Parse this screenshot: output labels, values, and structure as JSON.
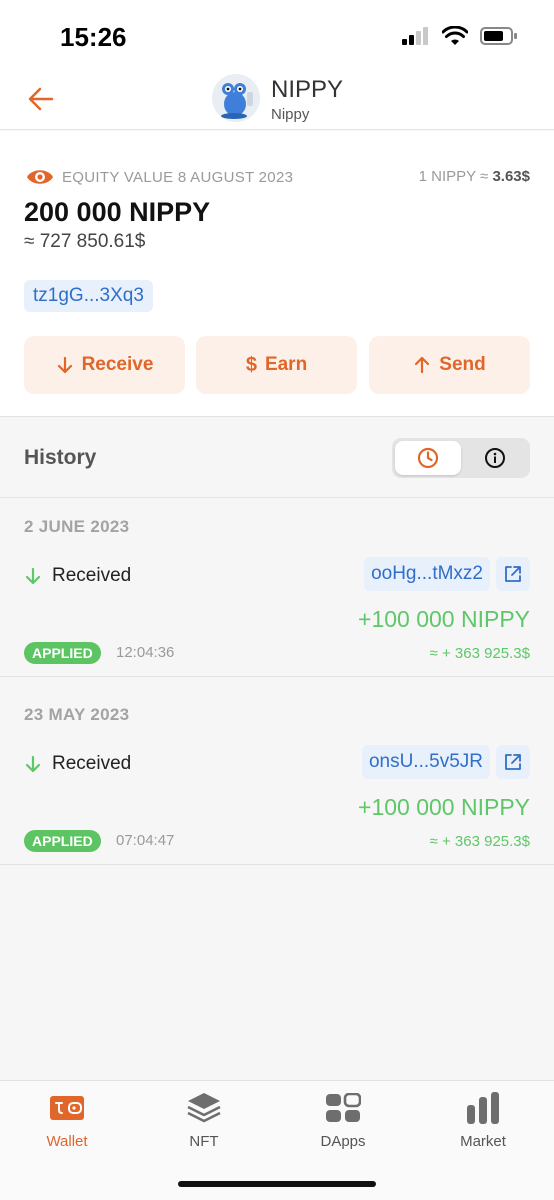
{
  "status_bar": {
    "time": "15:26"
  },
  "header": {
    "title": "NIPPY",
    "subtitle": "Nippy"
  },
  "balance": {
    "equity_label": "EQUITY VALUE 8 AUGUST 2023",
    "rate_prefix": "1 NIPPY ≈",
    "rate_value": "3.63$",
    "amount": "200 000 NIPPY",
    "usd": "≈ 727 850.61$",
    "address": "tz1gG...3Xq3"
  },
  "actions": [
    {
      "label": "Receive",
      "icon": "arrow-down-icon"
    },
    {
      "label": "Earn",
      "icon": "dollar-icon"
    },
    {
      "label": "Send",
      "icon": "arrow-up-icon"
    }
  ],
  "history": {
    "title": "History",
    "groups": [
      {
        "date": "2 JUNE 2023",
        "type": "Received",
        "hash": "ooHg...tMxz2",
        "amount": "+100 000 NIPPY",
        "status": "APPLIED",
        "time": "12:04:36",
        "usd": "≈ + 363 925.3$"
      },
      {
        "date": "23 MAY 2023",
        "type": "Received",
        "hash": "onsU...5v5JR",
        "amount": "+100 000 NIPPY",
        "status": "APPLIED",
        "time": "07:04:47",
        "usd": "≈ + 363 925.3$"
      }
    ]
  },
  "tabs": [
    {
      "label": "Wallet",
      "icon": "wallet-icon",
      "active": true
    },
    {
      "label": "NFT",
      "icon": "layers-icon",
      "active": false
    },
    {
      "label": "DApps",
      "icon": "dapps-grid-icon",
      "active": false
    },
    {
      "label": "Market",
      "icon": "bar-chart-icon",
      "active": false
    }
  ],
  "colors": {
    "accent": "#e0662a",
    "positive": "#5fc66a",
    "link": "#2f6fc9",
    "status_applied": "#5dc463"
  }
}
